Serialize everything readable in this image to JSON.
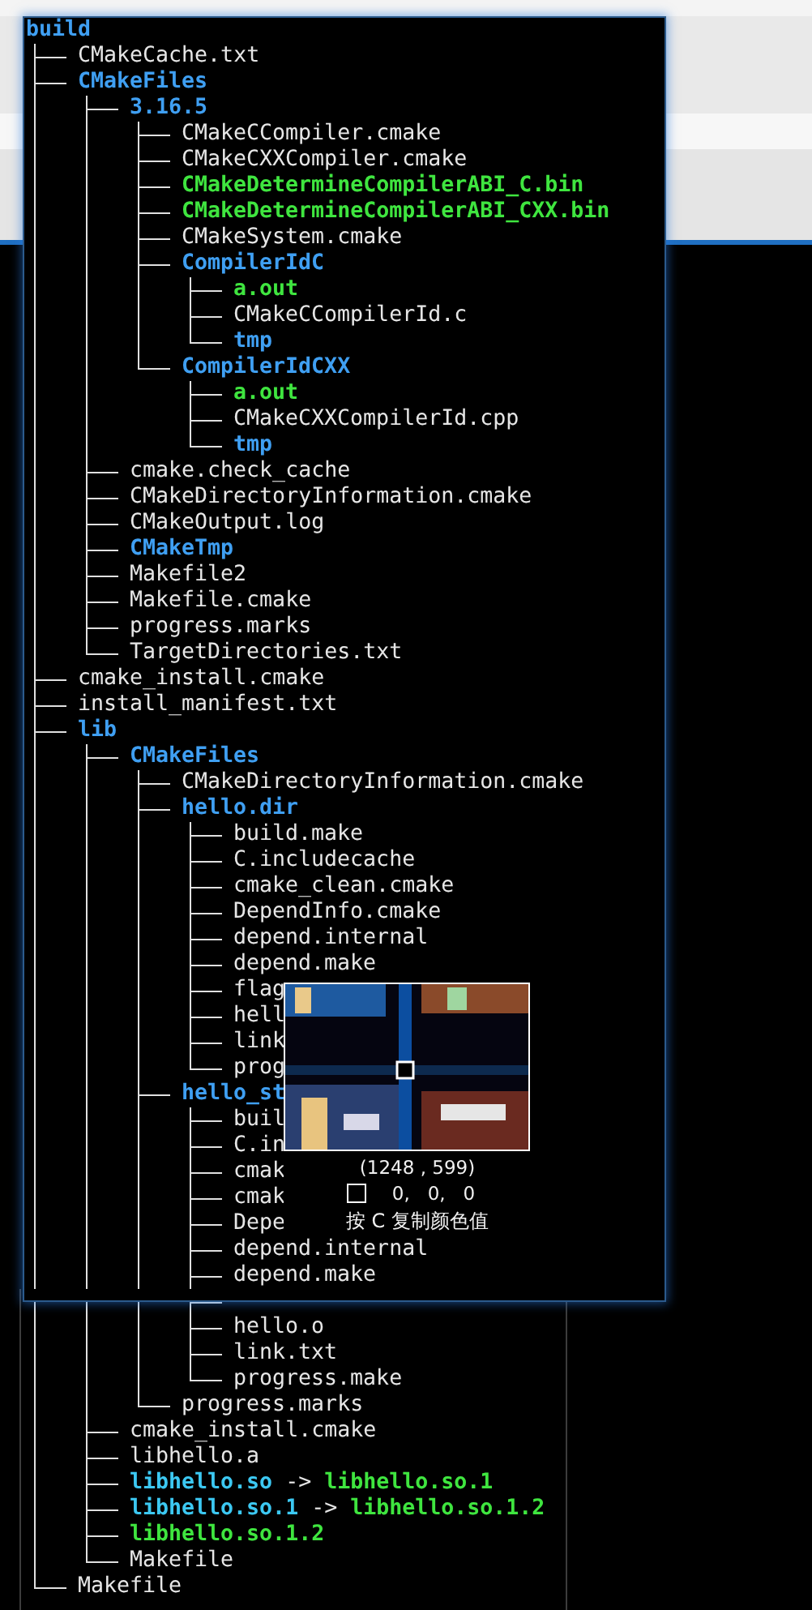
{
  "tree": {
    "name": "build",
    "kind": "dir",
    "children": [
      {
        "name": "CMakeCache.txt",
        "kind": "file"
      },
      {
        "name": "CMakeFiles",
        "kind": "dir",
        "children": [
          {
            "name": "3.16.5",
            "kind": "dir",
            "children": [
              {
                "name": "CMakeCCompiler.cmake",
                "kind": "file"
              },
              {
                "name": "CMakeCXXCompiler.cmake",
                "kind": "file"
              },
              {
                "name": "CMakeDetermineCompilerABI_C.bin",
                "kind": "exec"
              },
              {
                "name": "CMakeDetermineCompilerABI_CXX.bin",
                "kind": "exec"
              },
              {
                "name": "CMakeSystem.cmake",
                "kind": "file"
              },
              {
                "name": "CompilerIdC",
                "kind": "dir",
                "children": [
                  {
                    "name": "a.out",
                    "kind": "exec"
                  },
                  {
                    "name": "CMakeCCompilerId.c",
                    "kind": "file"
                  },
                  {
                    "name": "tmp",
                    "kind": "dir"
                  }
                ]
              },
              {
                "name": "CompilerIdCXX",
                "kind": "dir",
                "children": [
                  {
                    "name": "a.out",
                    "kind": "exec"
                  },
                  {
                    "name": "CMakeCXXCompilerId.cpp",
                    "kind": "file"
                  },
                  {
                    "name": "tmp",
                    "kind": "dir"
                  }
                ]
              }
            ]
          },
          {
            "name": "cmake.check_cache",
            "kind": "file"
          },
          {
            "name": "CMakeDirectoryInformation.cmake",
            "kind": "file"
          },
          {
            "name": "CMakeOutput.log",
            "kind": "file"
          },
          {
            "name": "CMakeTmp",
            "kind": "dir"
          },
          {
            "name": "Makefile2",
            "kind": "file"
          },
          {
            "name": "Makefile.cmake",
            "kind": "file"
          },
          {
            "name": "progress.marks",
            "kind": "file"
          },
          {
            "name": "TargetDirectories.txt",
            "kind": "file"
          }
        ]
      },
      {
        "name": "cmake_install.cmake",
        "kind": "file"
      },
      {
        "name": "install_manifest.txt",
        "kind": "file"
      },
      {
        "name": "lib",
        "kind": "dir",
        "children": [
          {
            "name": "CMakeFiles",
            "kind": "dir",
            "children": [
              {
                "name": "CMakeDirectoryInformation.cmake",
                "kind": "file"
              },
              {
                "name": "hello.dir",
                "kind": "dir",
                "children": [
                  {
                    "name": "build.make",
                    "kind": "file"
                  },
                  {
                    "name": "C.includecache",
                    "kind": "file"
                  },
                  {
                    "name": "cmake_clean.cmake",
                    "kind": "file"
                  },
                  {
                    "name": "DependInfo.cmake",
                    "kind": "file"
                  },
                  {
                    "name": "depend.internal",
                    "kind": "file"
                  },
                  {
                    "name": "depend.make",
                    "kind": "file"
                  },
                  {
                    "name": "flag",
                    "kind": "file"
                  },
                  {
                    "name": "hell",
                    "kind": "file"
                  },
                  {
                    "name": "link",
                    "kind": "file"
                  },
                  {
                    "name": "prog",
                    "kind": "file"
                  }
                ]
              },
              {
                "name": "hello_st",
                "kind": "dir",
                "children": [
                  {
                    "name": "buil",
                    "kind": "file"
                  },
                  {
                    "name": "C.in",
                    "kind": "file"
                  },
                  {
                    "name": "cmak",
                    "kind": "file"
                  },
                  {
                    "name": "cmak",
                    "kind": "file"
                  },
                  {
                    "name": "Depe",
                    "kind": "file"
                  },
                  {
                    "name": "depend.internal",
                    "kind": "file"
                  },
                  {
                    "name": "depend.make",
                    "kind": "file"
                  },
                  {
                    "kind": "covered"
                  },
                  {
                    "name": "hello.o",
                    "kind": "file"
                  },
                  {
                    "name": "link.txt",
                    "kind": "file"
                  },
                  {
                    "name": "progress.make",
                    "kind": "file"
                  }
                ]
              },
              {
                "name": "progress.marks",
                "kind": "file"
              }
            ]
          },
          {
            "name": "cmake_install.cmake",
            "kind": "file"
          },
          {
            "name": "libhello.a",
            "kind": "file"
          },
          {
            "name": "libhello.so",
            "kind": "link",
            "arrow": "->",
            "target": "libhello.so.1"
          },
          {
            "name": "libhello.so.1",
            "kind": "link",
            "arrow": "->",
            "target": "libhello.so.1.2"
          },
          {
            "name": "libhello.so.1.2",
            "kind": "exec"
          },
          {
            "name": "Makefile",
            "kind": "file"
          }
        ]
      },
      {
        "name": "Makefile",
        "kind": "file"
      }
    ]
  },
  "color_picker": {
    "coordinates": "(1248 , 599)",
    "color": "#000000",
    "rgb": "0,   0,   0",
    "hint": "按 C 复制颜色值"
  }
}
